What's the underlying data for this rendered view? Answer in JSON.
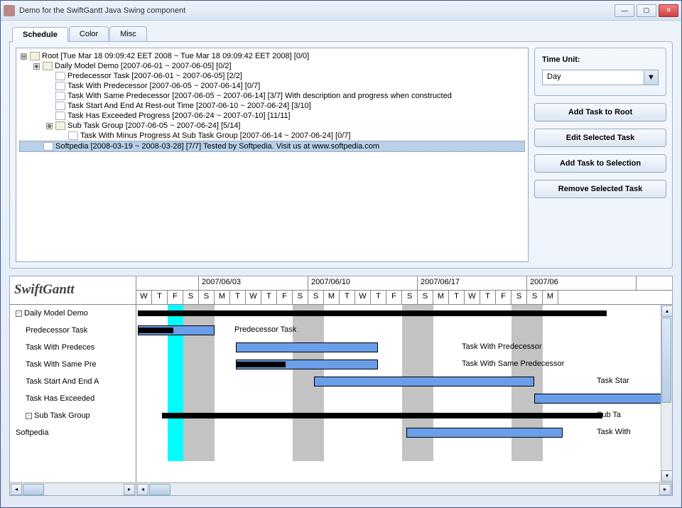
{
  "window": {
    "title": "Demo for the SwiftGantt Java Swing component"
  },
  "tabs": [
    {
      "label": "Schedule",
      "active": true
    },
    {
      "label": "Color",
      "active": false
    },
    {
      "label": "Misc",
      "active": false
    }
  ],
  "tree": [
    {
      "level": 0,
      "icon": "folder",
      "expand": "-",
      "text": "Root   [Tue Mar 18 09:09:42 EET 2008 ~ Tue Mar 18 09:09:42 EET 2008]   [0/0]"
    },
    {
      "level": 1,
      "icon": "folder",
      "expand": "o",
      "text": "Daily Model Demo   [2007-06-01 ~ 2007-06-05]   [0/2]"
    },
    {
      "level": 2,
      "icon": "doc",
      "text": "Predecessor Task   [2007-06-01 ~ 2007-06-05]   [2/2]"
    },
    {
      "level": 2,
      "icon": "doc",
      "text": "Task With Predecessor   [2007-06-05 ~ 2007-06-14]   [0/7]"
    },
    {
      "level": 2,
      "icon": "doc",
      "text": "Task With Same Predecessor   [2007-06-05 ~ 2007-06-14]   [3/7]   With description and progress when constructed"
    },
    {
      "level": 2,
      "icon": "doc",
      "text": "Task Start And End At Rest-out Time   [2007-06-10 ~ 2007-06-24]   [3/10]"
    },
    {
      "level": 2,
      "icon": "doc",
      "text": "Task Has Exceeded Progress   [2007-06-24 ~ 2007-07-10]   [11/11]"
    },
    {
      "level": 2,
      "icon": "folder",
      "expand": "o",
      "text": "Sub Task Group   [2007-06-05 ~ 2007-06-24]   [5/14]"
    },
    {
      "level": 3,
      "icon": "doc",
      "text": "Task With Minus Progress At Sub Task Group   [2007-06-14 ~ 2007-06-24]   [0/7]"
    },
    {
      "level": 1,
      "icon": "doc",
      "selected": true,
      "text": "Softpedia   [2008-03-19 ~ 2008-03-28]   [7/7]   Tested by Softpedia. Visit us at www.softpedia.com"
    }
  ],
  "sidepanel": {
    "time_label": "Time Unit:",
    "time_value": "Day",
    "buttons": {
      "add_root": "Add Task to Root",
      "edit": "Edit Selected Task",
      "add_sel": "Add Task to Selection",
      "remove": "Remove Selected Task"
    }
  },
  "gantt": {
    "logo": "SwiftGantt",
    "tasks": [
      {
        "label": "Daily Model Demo",
        "level": 0,
        "expand": "-"
      },
      {
        "label": "Predecessor Task",
        "level": 1
      },
      {
        "label": "Task With Predeces",
        "level": 1
      },
      {
        "label": "Task With Same Pre",
        "level": 1
      },
      {
        "label": "Task Start And End A",
        "level": 1
      },
      {
        "label": "Task Has Exceeded",
        "level": 1
      },
      {
        "label": "Sub Task Group",
        "level": 1,
        "expand": "-"
      },
      {
        "label": "Softpedia",
        "level": 0
      }
    ],
    "date_headers": [
      "",
      "2007/06/03",
      "2007/06/10",
      "2007/06/17",
      "2007/06"
    ],
    "day_headers": [
      "W",
      "T",
      "F",
      "S",
      "S",
      "M",
      "T",
      "W",
      "T",
      "F",
      "S",
      "S",
      "M",
      "T",
      "W",
      "T",
      "F",
      "S",
      "S",
      "M",
      "T",
      "W",
      "T",
      "F",
      "S",
      "S",
      "M"
    ],
    "bar_labels": {
      "pred": "Predecessor Task",
      "withpred": "Task With Predecessor",
      "samepred": "Task With Same Predecessor",
      "start": "Task Star",
      "subgroup": "Sub Ta",
      "minus": "Task With"
    }
  }
}
